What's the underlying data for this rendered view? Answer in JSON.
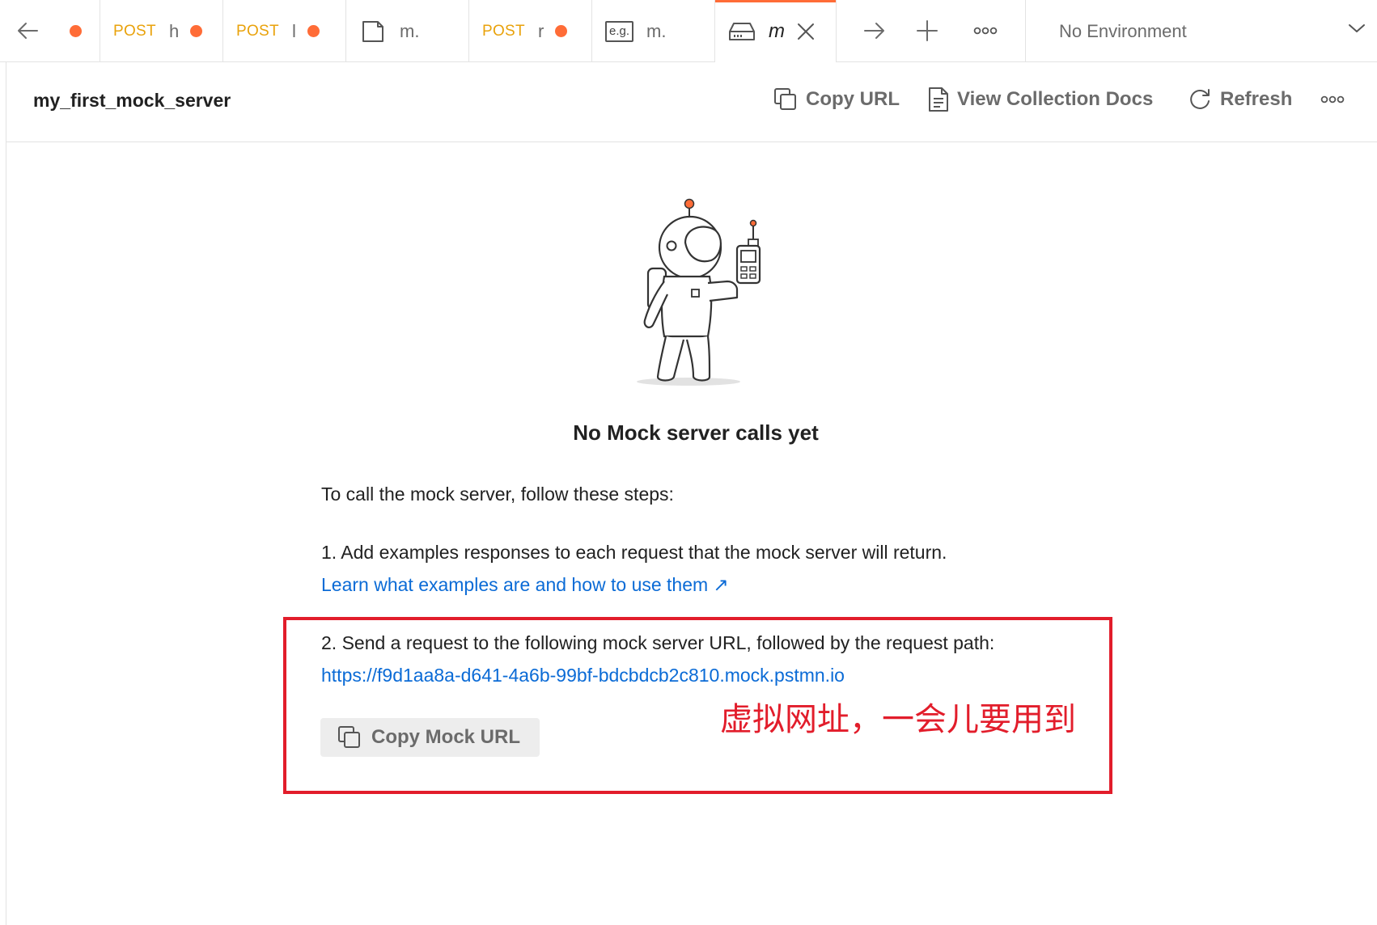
{
  "tabs": [
    {
      "method": "",
      "name": "",
      "unsaved": true,
      "icon": "none"
    },
    {
      "method": "POST",
      "name": "h",
      "unsaved": true,
      "icon": "none"
    },
    {
      "method": "POST",
      "name": "l",
      "unsaved": true,
      "icon": "none"
    },
    {
      "method": "",
      "name": "m.",
      "unsaved": false,
      "icon": "collection-icon"
    },
    {
      "method": "POST",
      "name": "r",
      "unsaved": true,
      "icon": "none"
    },
    {
      "method": "",
      "name": "m.",
      "unsaved": false,
      "icon": "example-icon"
    },
    {
      "method": "",
      "name": "m",
      "unsaved": false,
      "icon": "mock-server-icon",
      "active": true
    }
  ],
  "example_icon_text": "e.g.",
  "environment": {
    "label": "No Environment"
  },
  "header": {
    "title": "my_first_mock_server",
    "copy_url_label": "Copy URL",
    "view_docs_label": "View Collection Docs",
    "refresh_label": "Refresh"
  },
  "empty_state": {
    "title": "No Mock server calls yet",
    "intro": "To call the mock server, follow these steps:",
    "step1": "1. Add examples responses to each request that the mock server will return.",
    "step1_link": "Learn what examples are and how to use them ↗",
    "step2": "2. Send a request to the following mock server URL, followed by the request path:",
    "mock_url": "https://f9d1aa8a-d641-4a6b-99bf-bdcbdcb2c810.mock.pstmn.io",
    "copy_mock_label": "Copy Mock URL"
  },
  "annotation": {
    "text": "虚拟网址，一会儿要用到"
  },
  "colors": {
    "accent": "#ff6c37",
    "method_post": "#e9a20b",
    "link": "#0b6bd6",
    "annotation_red": "#e21d2b"
  }
}
